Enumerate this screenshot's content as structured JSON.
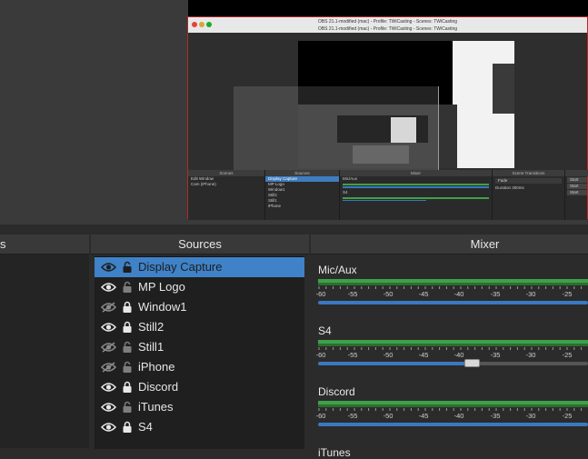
{
  "preview": {
    "title_line1": "OBS 21.1-modified (mac) - Profile: TWiCasting - Scenes: TWiCasting",
    "title_line2": "OBS 21.1-modified (mac) - Profile: TWiCasting - Scenes: TWiCasting",
    "panels": {
      "scenes_header": "Scenes",
      "sources_header": "Sources",
      "mixer_header": "Mixer",
      "transitions_header": "Scene Transitions",
      "scenes": [
        "Edit Window",
        "Cam (iPhone)"
      ],
      "sources": [
        "Display Capture",
        "MP Logo",
        "Window1",
        "Still2",
        "Still1",
        "iPhone"
      ],
      "mixer_channels": [
        "Mic/Aux",
        "S4"
      ],
      "transition": "Fade",
      "duration_label": "Duration",
      "duration_value": "300ms",
      "controls": [
        "Start",
        "Start",
        "Start"
      ]
    }
  },
  "dock": {
    "scenes_header": "s",
    "sources_header": "Sources",
    "mixer_header": "Mixer"
  },
  "sources": [
    {
      "name": "Display Capture",
      "visible": true,
      "locked": false,
      "selected": true
    },
    {
      "name": "MP Logo",
      "visible": true,
      "locked": false,
      "selected": false
    },
    {
      "name": "Window1",
      "visible": false,
      "locked": true,
      "selected": false
    },
    {
      "name": "Still2",
      "visible": true,
      "locked": true,
      "selected": false
    },
    {
      "name": "Still1",
      "visible": false,
      "locked": false,
      "selected": false
    },
    {
      "name": "iPhone",
      "visible": false,
      "locked": false,
      "selected": false
    },
    {
      "name": "Discord",
      "visible": true,
      "locked": true,
      "selected": false
    },
    {
      "name": "iTunes",
      "visible": true,
      "locked": false,
      "selected": false
    },
    {
      "name": "S4",
      "visible": true,
      "locked": true,
      "selected": false
    }
  ],
  "mixer": {
    "tick_labels": [
      "-60",
      "-55",
      "-50",
      "-45",
      "-40",
      "-35",
      "-30",
      "-25"
    ],
    "channels": [
      {
        "name": "Mic/Aux",
        "fader_level": 1.0
      },
      {
        "name": "S4",
        "fader_level": 0.57
      },
      {
        "name": "Discord",
        "fader_level": 1.0
      },
      {
        "name": "iTunes"
      }
    ]
  },
  "colors": {
    "selection": "#3f82c8",
    "meter_green": "#3ea14a",
    "fader_blue": "#3979c2",
    "preview_border": "#b02a2a"
  }
}
